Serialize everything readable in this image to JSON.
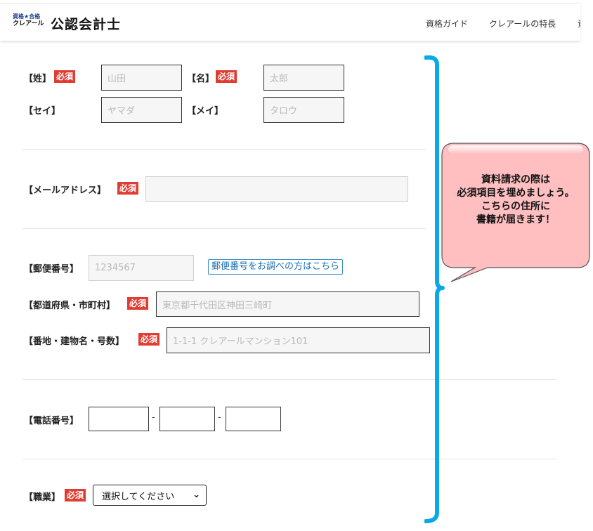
{
  "header": {
    "logo_small_line1": "資格★合格",
    "logo_small_line2": "クレアール",
    "logo_main": "公認会計士",
    "nav": [
      "資格ガイド",
      "クレアールの特長",
      "資"
    ]
  },
  "form": {
    "required_badge": "必須",
    "last_name": {
      "label": "【姓】",
      "placeholder": "山田"
    },
    "first_name": {
      "label": "【名】",
      "placeholder": "太郎"
    },
    "last_kana": {
      "label": "【セイ】",
      "placeholder": "ヤマダ"
    },
    "first_kana": {
      "label": "【メイ】",
      "placeholder": "タロウ"
    },
    "email": {
      "label": "【メールアドレス】",
      "placeholder": ""
    },
    "zip": {
      "label": "【郵便番号】",
      "placeholder": "1234567",
      "lookup_link": "郵便番号をお調べの方はこちら"
    },
    "prefecture_city": {
      "label": "【都道府県・市町村】",
      "placeholder": "東京都千代田区神田三崎町"
    },
    "address_line": {
      "label": "【番地・建物名・号数】",
      "placeholder": "1-1-1 クレアールマンション101"
    },
    "phone": {
      "label": "【電話番号】",
      "separator": "-"
    },
    "occupation": {
      "label": "【職業】",
      "selected": "選択してください"
    }
  },
  "callout": {
    "lines": [
      "資料請求の際は",
      "必須項目を埋めましょう。",
      "こちらの住所に",
      "書籍が届きます！"
    ]
  },
  "colors": {
    "required_badge": "#e03c31",
    "bracket": "#0aa8e8",
    "callout_fill": "#ffbfc1",
    "link": "#1f6fb5"
  }
}
